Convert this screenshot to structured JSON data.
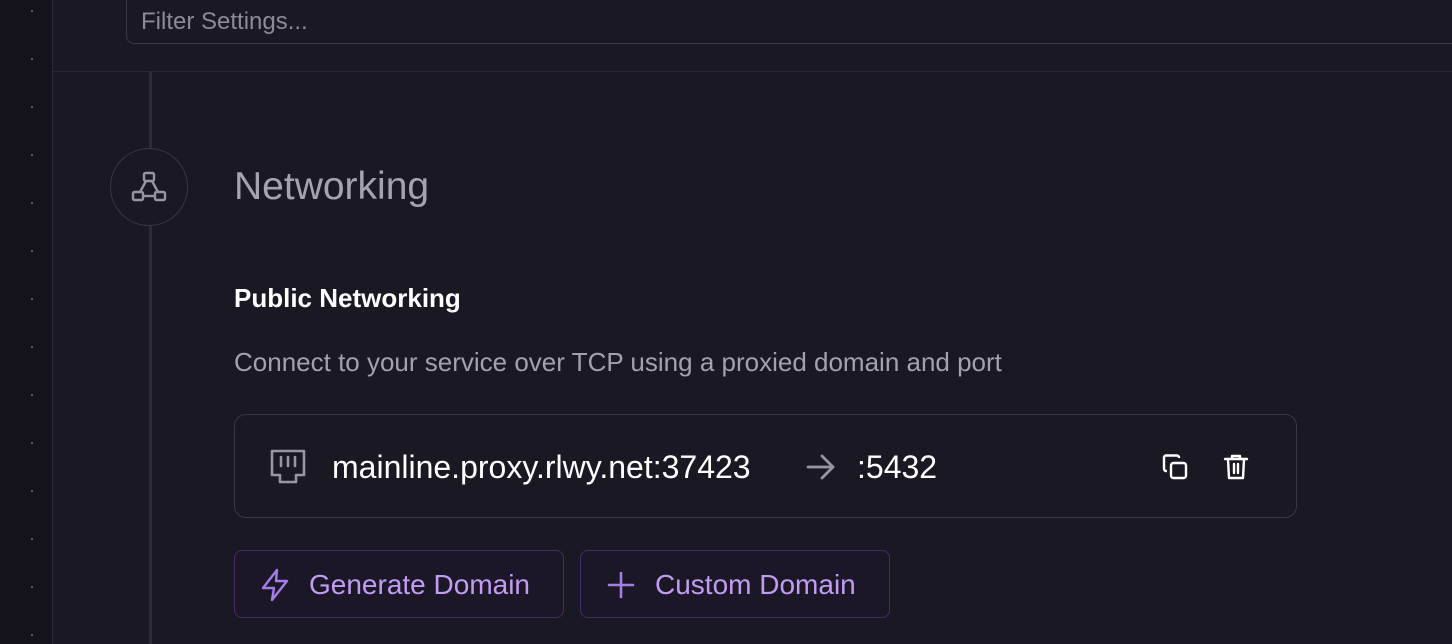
{
  "filter": {
    "placeholder": "Filter Settings..."
  },
  "section": {
    "icon": "network-nodes-icon",
    "title": "Networking"
  },
  "public_networking": {
    "heading": "Public Networking",
    "description": "Connect to your service over TCP using a proxied domain and port",
    "entry": {
      "icon": "ethernet-port-icon",
      "domain": "mainline.proxy.rlwy.net:37423",
      "arrow_icon": "arrow-right-icon",
      "port": ":5432",
      "copy_icon": "copy-icon",
      "delete_icon": "trash-icon"
    }
  },
  "actions": {
    "generate_domain": {
      "label": "Generate Domain",
      "icon": "lightning-icon"
    },
    "custom_domain": {
      "label": "Custom Domain",
      "icon": "plus-icon"
    }
  },
  "colors": {
    "background": "#1a1823",
    "rail": "#14131b",
    "border": "#3a3846",
    "accent": "#c29cf3",
    "accent_border": "#452a6e"
  }
}
